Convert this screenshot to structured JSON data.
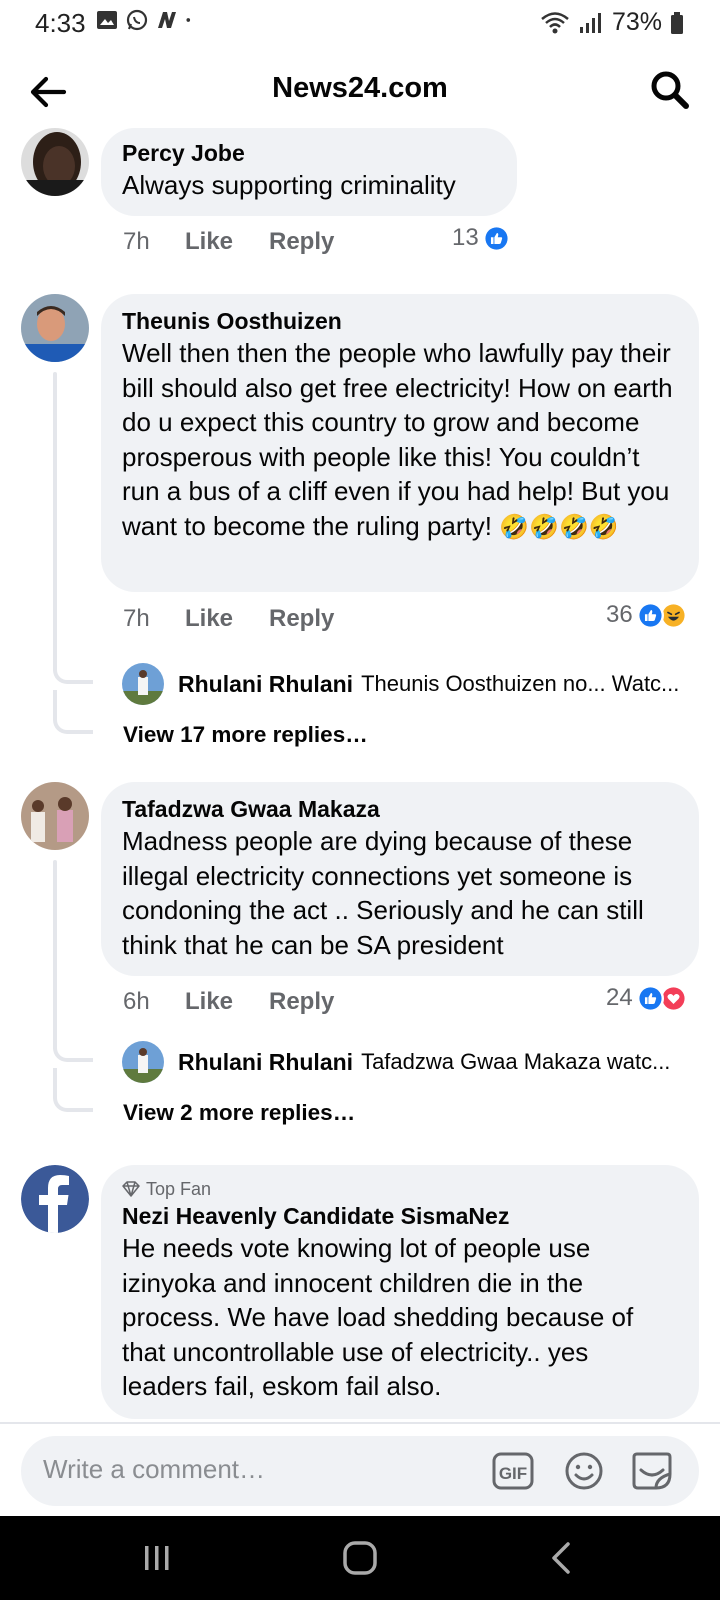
{
  "status_bar": {
    "time": "4:33",
    "battery": "73%",
    "icons": [
      "gallery-icon",
      "whatsapp-icon",
      "news-icon",
      "dot-icon",
      "wifi-icon",
      "signal-icon",
      "battery-icon"
    ]
  },
  "header": {
    "title": "News24.com",
    "back_icon": "arrow-left-icon",
    "search_icon": "search-icon"
  },
  "comments": [
    {
      "name": "Percy Jobe",
      "text": "Always supporting criminality",
      "time": "7h",
      "like": "Like",
      "reply": "Reply",
      "reactions": "13",
      "reaction_icons": [
        "like-icon"
      ]
    },
    {
      "name": "Theunis Oosthuizen",
      "text": "Well then then the people who lawfully pay their bill should also get free electricity! How on earth do u expect this country to grow and become prosperous with people like this! You couldn’t run a bus of a cliff even if you had help! But you want to become the ruling party!",
      "emoji": "🤣🤣🤣🤣",
      "time": "7h",
      "like": "Like",
      "reply": "Reply",
      "reactions": "36",
      "reaction_icons": [
        "like-icon",
        "haha-icon"
      ],
      "reply_preview": {
        "name": "Rhulani Rhulani",
        "text": "Theunis Oosthuizen no... Watc..."
      },
      "view_more": "View 17 more replies…"
    },
    {
      "name": "Tafadzwa Gwaa Makaza",
      "text": "Madness people are dying because of these illegal electricity connections yet someone is condoning the act .. Seriously and he can still think that he can be SA president",
      "time": "6h",
      "like": "Like",
      "reply": "Reply",
      "reactions": "24",
      "reaction_icons": [
        "like-icon",
        "love-icon"
      ],
      "reply_preview": {
        "name": "Rhulani Rhulani",
        "text": "Tafadzwa Gwaa Makaza watc..."
      },
      "view_more": "View 2 more replies…"
    },
    {
      "badge": "Top Fan",
      "name": "Nezi Heavenly Candidate SismaNez",
      "text": "He needs vote knowing lot of people use izinyoka and innocent children die in the process. We have load shedding because of that uncontrollable use of electricity.. yes leaders fail, eskom fail also."
    }
  ],
  "composer": {
    "placeholder": "Write a comment…",
    "gif_label": "GIF"
  },
  "colors": {
    "accent": "#1877f2",
    "bubble": "#f0f2f5",
    "secondary_text": "#65676b",
    "love": "#f33e58",
    "haha": "#f7b125"
  }
}
